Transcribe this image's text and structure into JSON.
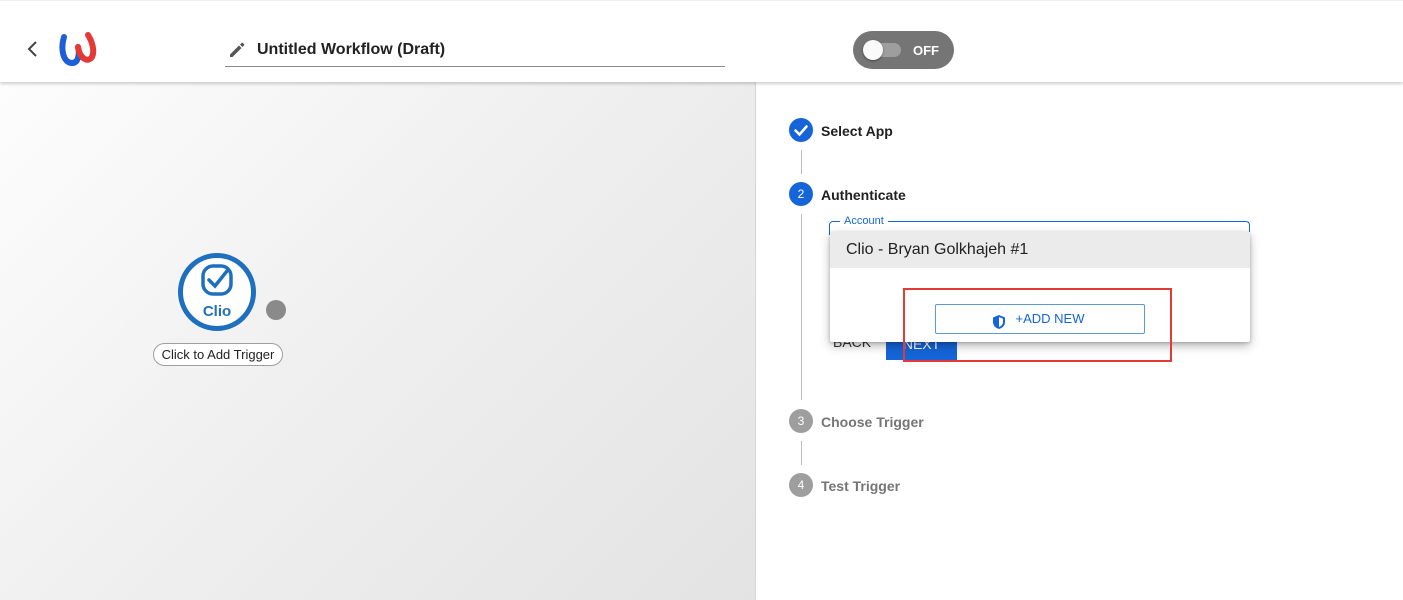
{
  "header": {
    "title": "Untitled Workflow (Draft)",
    "toggle_label": "OFF",
    "toggle_state": "off"
  },
  "canvas": {
    "node_app_name": "Clio",
    "trigger_pill": "Click to Add Trigger"
  },
  "stepper": {
    "steps": [
      {
        "label": "Select App",
        "marker": "check",
        "state": "completed"
      },
      {
        "label": "Authenticate",
        "marker": "2",
        "state": "active"
      },
      {
        "label": "Choose Trigger",
        "marker": "3",
        "state": "inactive"
      },
      {
        "label": "Test Trigger",
        "marker": "4",
        "state": "inactive"
      }
    ],
    "back_label": "BACK",
    "next_label": "NEXT"
  },
  "account": {
    "label": "Account",
    "options": [
      "Clio - Bryan Golkhajeh #1"
    ],
    "add_new_label": "+ADD NEW"
  },
  "colors": {
    "accent": "#1565d8",
    "highlight": "#e53935",
    "clio_blue": "#1f6fbf",
    "toggle_bg": "#757575"
  }
}
